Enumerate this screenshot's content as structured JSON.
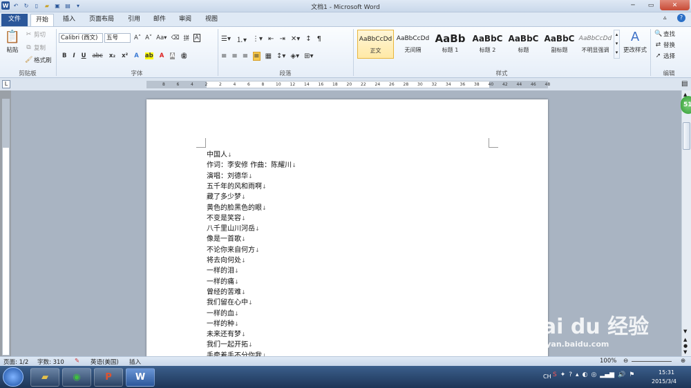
{
  "window": {
    "title": "文档1 - Microsoft Word"
  },
  "tabs": [
    "文件",
    "开始",
    "插入",
    "页面布局",
    "引用",
    "邮件",
    "审阅",
    "视图"
  ],
  "clipboard": {
    "paste": "粘贴",
    "cut": "剪切",
    "copy": "复制",
    "format_painter": "格式刷",
    "group": "剪贴板"
  },
  "font": {
    "name": "Calibri (西文)",
    "size": "五号",
    "group": "字体"
  },
  "paragraph": {
    "group": "段落"
  },
  "styles": {
    "group": "样式",
    "items": [
      {
        "sample": "AaBbCcDd",
        "name": "正文"
      },
      {
        "sample": "AaBbCcDd",
        "name": "无间隔"
      },
      {
        "sample": "AaBb",
        "name": "标题 1"
      },
      {
        "sample": "AaBbC",
        "name": "标题 2"
      },
      {
        "sample": "AaBbC",
        "name": "标题"
      },
      {
        "sample": "AaBbC",
        "name": "副标题"
      },
      {
        "sample": "AaBbCcDd",
        "name": "不明显强调"
      }
    ],
    "change": "更改样式"
  },
  "editing": {
    "find": "查找",
    "replace": "替换",
    "select": "选择",
    "group": "编辑"
  },
  "ruler_ticks": [
    "8",
    "6",
    "4",
    "2",
    "2",
    "4",
    "6",
    "8",
    "10",
    "12",
    "14",
    "16",
    "18",
    "20",
    "22",
    "24",
    "26",
    "28",
    "30",
    "32",
    "34",
    "36",
    "38",
    "40",
    "42",
    "44",
    "46",
    "48"
  ],
  "document": {
    "lines": [
      "中国人",
      "作词：李安修 作曲：陈耀川",
      "演唱：刘德华",
      "五千年的风和雨啊",
      "藏了多少梦",
      "黄色的脸黑色的眼",
      "不变是笑容",
      "八千里山川河岳",
      "像是一首歌",
      "不论你来自何方",
      "将去向何处",
      "一样的泪",
      "一样的痛",
      "曾经的苦难",
      "我们留在心中",
      "一样的血",
      "一样的种",
      "未来还有梦",
      "我们一起开拓",
      "手牵着手不分你我"
    ]
  },
  "status": {
    "page": "页面: 1/2",
    "words": "字数: 310",
    "language": "英语(美国)",
    "mode": "插入",
    "zoom": "100%"
  },
  "tray": {
    "lang": "CH",
    "time": "15:31",
    "date": "2015/3/4"
  },
  "watermark": {
    "brand": "Bai du 经验",
    "url": "jingyan.baidu.com"
  },
  "badge": "51"
}
